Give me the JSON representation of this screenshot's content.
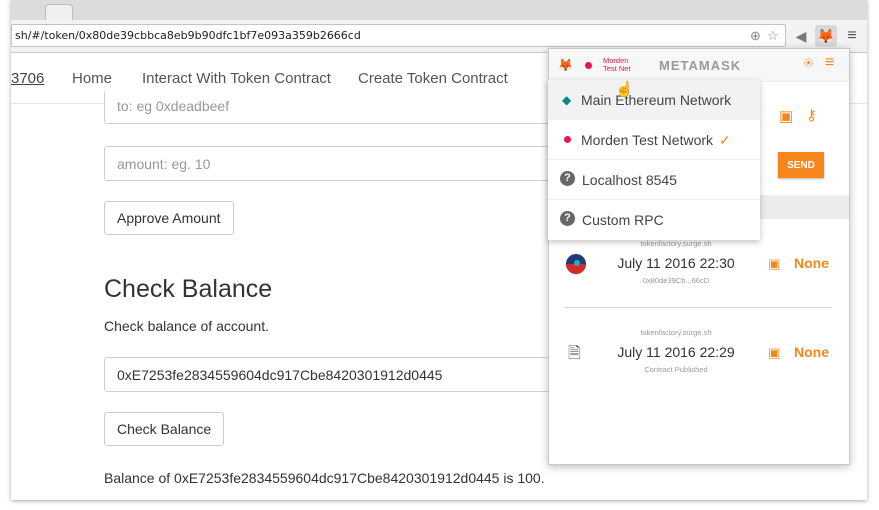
{
  "browser": {
    "url": "sh/#/token/0x80de39cbbca8eb9b90dfc1bf7e093a359b2666cd",
    "zoom_icon": "zoom-icon",
    "star_icon": "star-icon",
    "extension_icon": "metamask-fox-icon",
    "menu_icon": "hamburger-icon"
  },
  "nav": {
    "brand": "3706",
    "links": [
      "Home",
      "Interact With Token Contract",
      "Create Token Contract"
    ]
  },
  "main": {
    "to_placeholder": "to: eg 0xdeadbeef",
    "amount_placeholder": "amount: eg. 10",
    "approve_button": "Approve Amount",
    "section_heading": "Check Balance",
    "section_desc": "Check balance of account.",
    "address_value": "0xE7253fe2834559604dc917Cbe8420301912d0445",
    "check_button": "Check Balance",
    "result_text": "Balance of 0xE7253fe2834559604dc917Cbe8420301912d0445 is 100."
  },
  "metamask": {
    "title": "METAMASK",
    "network_line1": "Morden",
    "network_line2": "Test Net",
    "send_label": "SEND",
    "networks": [
      {
        "label": "Main Ethereum Network",
        "icon": "diamond-icon",
        "color": "#038789"
      },
      {
        "label": "Morden Test Network",
        "icon": "dot-icon",
        "color": "#e91550",
        "selected": "✓"
      },
      {
        "label": "Localhost 8545",
        "icon": "question-icon"
      },
      {
        "label": "Custom RPC",
        "icon": "question-icon"
      }
    ],
    "transactions": [
      {
        "domain": "tokenfactory.surge.sh",
        "date": "July 11 2016 22:30",
        "sub": "0x80de39Cb...66cD",
        "value": "None"
      },
      {
        "domain": "tokenfactory.surge.sh",
        "date": "July 11 2016 22:29",
        "sub": "Contract Published",
        "value": "None"
      }
    ],
    "accent_color": "#f6851b"
  }
}
